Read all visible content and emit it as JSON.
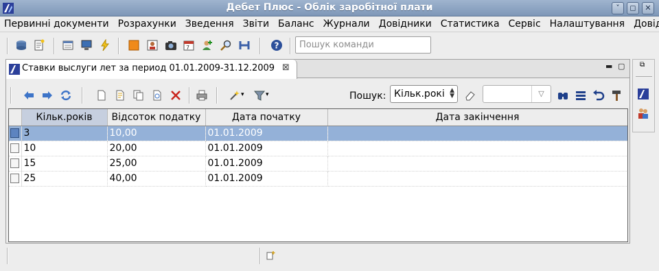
{
  "window": {
    "title": "Дебет Плюс - Облік заробітної плати",
    "buttons": [
      "˅",
      "◻",
      "✕"
    ]
  },
  "menu": [
    "Первинні документи",
    "Розрахунки",
    "Зведення",
    "Звіти",
    "Баланс",
    "Журнали",
    "Довідники",
    "Статистика",
    "Сервіс",
    "Налаштування",
    "Довідка"
  ],
  "main_toolbar": {
    "command_search_placeholder": "Пошук команди"
  },
  "tab": {
    "title": "Ставки выслуги лет за период 01.01.2009-31.12.2009",
    "close": "⊠"
  },
  "view_buttons": {
    "minimize": "▬",
    "maximize": "▢"
  },
  "search": {
    "label": "Пошук:",
    "field": "Кільк.рокі",
    "value": ""
  },
  "table": {
    "columns": [
      "Кільк.років",
      "Відсоток податку",
      "Дата початку",
      "Дата закінчення"
    ],
    "sorted_column": "Кільк.років",
    "rows": [
      {
        "years": "3",
        "percent": "10,00",
        "start": "01.01.2009",
        "end": "",
        "selected": true
      },
      {
        "years": "10",
        "percent": "20,00",
        "start": "01.01.2009",
        "end": "",
        "selected": false
      },
      {
        "years": "15",
        "percent": "25,00",
        "start": "01.01.2009",
        "end": "",
        "selected": false
      },
      {
        "years": "25",
        "percent": "40,00",
        "start": "01.01.2009",
        "end": "",
        "selected": false
      }
    ]
  },
  "colors": {
    "titlebar": "#8aa0bf",
    "selection": "#94b1d8",
    "sorted_header": "#c6cfdf"
  }
}
